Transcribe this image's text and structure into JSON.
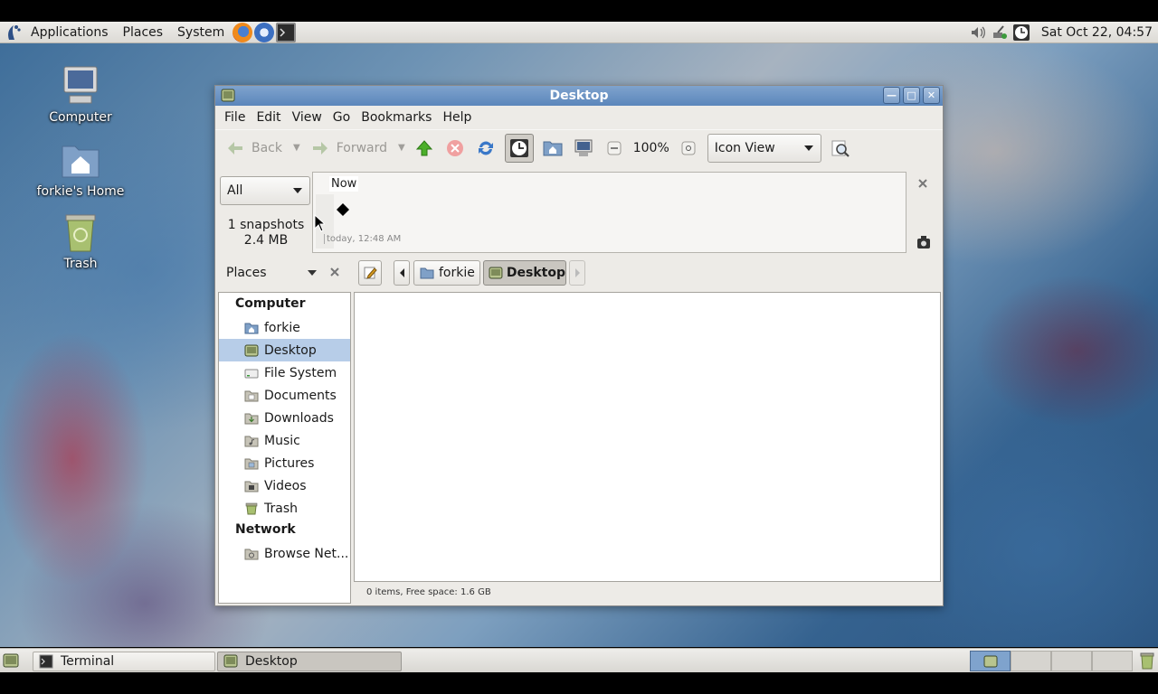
{
  "top_panel": {
    "menus": [
      "Applications",
      "Places",
      "System"
    ],
    "clock": "Sat Oct 22, 04:57"
  },
  "desktop_icons": [
    {
      "label": "Computer"
    },
    {
      "label": "forkie's Home"
    },
    {
      "label": "Trash"
    }
  ],
  "window": {
    "title": "Desktop",
    "menubar": [
      "File",
      "Edit",
      "View",
      "Go",
      "Bookmarks",
      "Help"
    ],
    "toolbar": {
      "back_label": "Back",
      "forward_label": "Forward",
      "zoom": "100%",
      "view_mode": "Icon View"
    },
    "snapshots": {
      "filter": "All",
      "count_text": "1 snapshots",
      "size_text": "2.4 MB",
      "now_label": "Now",
      "timestamp": "today, 12:48 AM"
    },
    "sidebar": {
      "selector": "Places",
      "sections": [
        {
          "heading": "Computer",
          "items": [
            "forkie",
            "Desktop",
            "File System",
            "Documents",
            "Downloads",
            "Music",
            "Pictures",
            "Videos",
            "Trash"
          ]
        },
        {
          "heading": "Network",
          "items": [
            "Browse Net..."
          ]
        }
      ],
      "selected": "Desktop"
    },
    "path": [
      "forkie",
      "Desktop"
    ],
    "status": "0 items, Free space: 1.6 GB"
  },
  "bottom_panel": {
    "tasks": [
      "Terminal",
      "Desktop"
    ]
  },
  "colors": {
    "titlebar": "#6a93c3",
    "selection": "#b7cde8",
    "panel": "#e6e4e0"
  }
}
